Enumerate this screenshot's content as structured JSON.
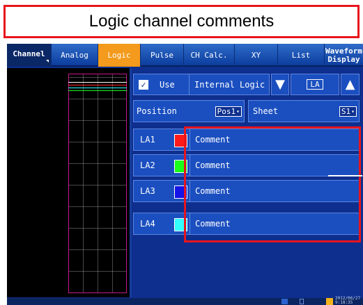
{
  "caption": "Logic channel comments",
  "tabs": [
    {
      "label": "Channel",
      "active": false
    },
    {
      "label": "Analog",
      "active": false
    },
    {
      "label": "Logic",
      "active": true
    },
    {
      "label": "Pulse",
      "active": false
    },
    {
      "label": "CH Calc.",
      "active": false
    },
    {
      "label": "XY",
      "active": false
    },
    {
      "label": "List",
      "active": false
    },
    {
      "label": "Waveform Display",
      "line1": "Waveform",
      "line2": "Display",
      "active": false
    }
  ],
  "controls": {
    "use_label": "Use",
    "use_checked": true,
    "source": "Internal Logic",
    "unit": "LA",
    "position_label": "Position",
    "position_value": "Pos1",
    "sheet_label": "Sheet",
    "sheet_value": "S1"
  },
  "channels": [
    {
      "label": "LA1",
      "color": "#ff1a1a",
      "comment": "Comment"
    },
    {
      "label": "LA2",
      "color": "#1aff1a",
      "comment": "Comment"
    },
    {
      "label": "LA3",
      "color": "#1414e6",
      "comment": "Comment"
    },
    {
      "label": "LA4",
      "color": "#33ffff",
      "comment": "Comment"
    }
  ],
  "status": {
    "date_line1": "2012/06/27",
    "date_line2": "9:18:35"
  },
  "colors": {
    "highlight": "#e8141c",
    "active_tab": "#f49a1c",
    "panel": "#1b4fc0",
    "background": "#0e2f8e"
  }
}
